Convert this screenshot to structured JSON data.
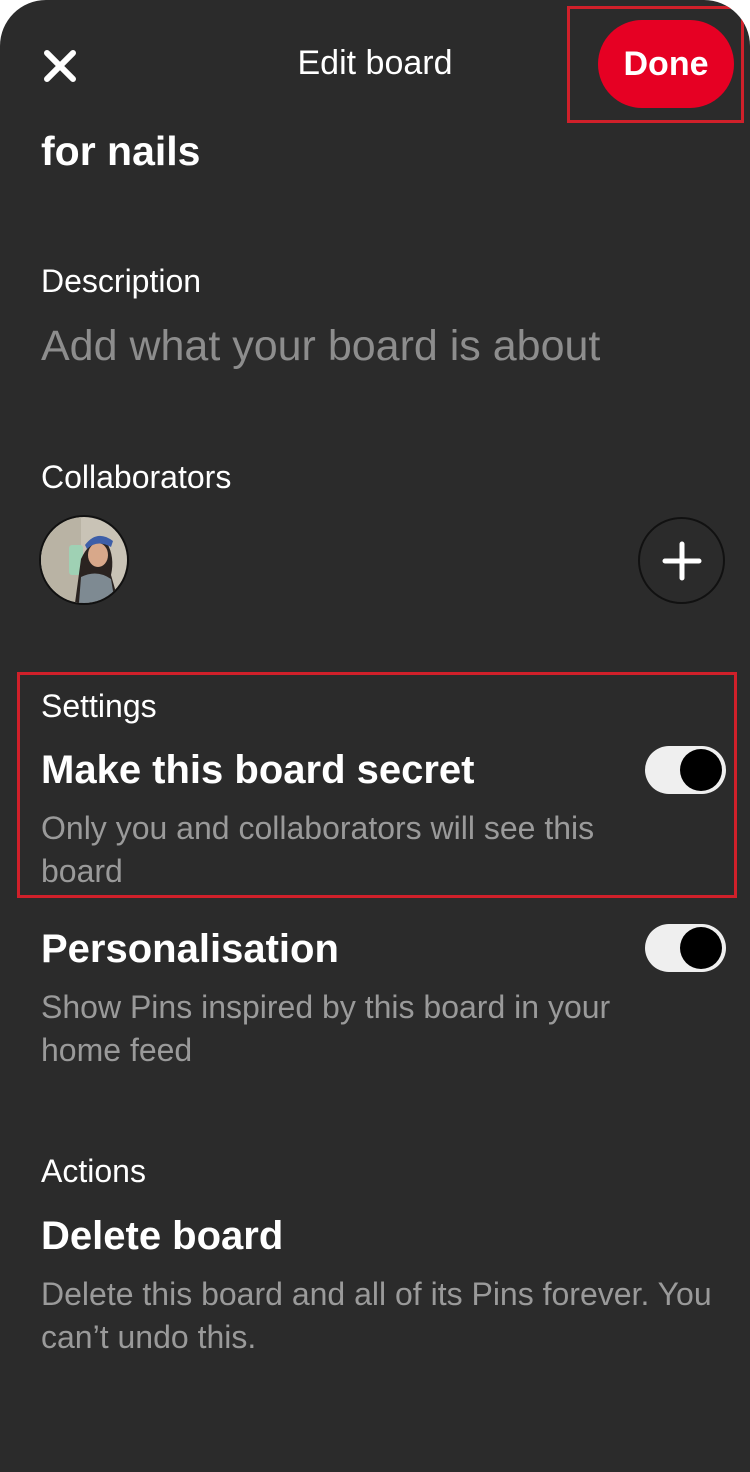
{
  "header": {
    "title": "Edit board",
    "done_label": "Done",
    "close_icon": "close-icon"
  },
  "board": {
    "name": "for nails"
  },
  "description": {
    "label": "Description",
    "placeholder": "Add what your board is about"
  },
  "collaborators": {
    "label": "Collaborators",
    "add_icon": "plus-icon"
  },
  "settings": {
    "label": "Settings",
    "secret": {
      "title": "Make this board secret",
      "subtitle": "Only you and collaborators will see this board",
      "enabled": true
    },
    "personalisation": {
      "title": "Personalisation",
      "subtitle": "Show Pins inspired by this board in your home feed",
      "enabled": true
    }
  },
  "actions": {
    "label": "Actions",
    "delete": {
      "title": "Delete board",
      "subtitle": "Delete this board and all of its Pins forever. You can’t undo this."
    }
  },
  "colors": {
    "background": "#2b2b2b",
    "accent": "#e60023",
    "highlight_box": "#d0202a",
    "muted_text": "#9a9a9a"
  }
}
